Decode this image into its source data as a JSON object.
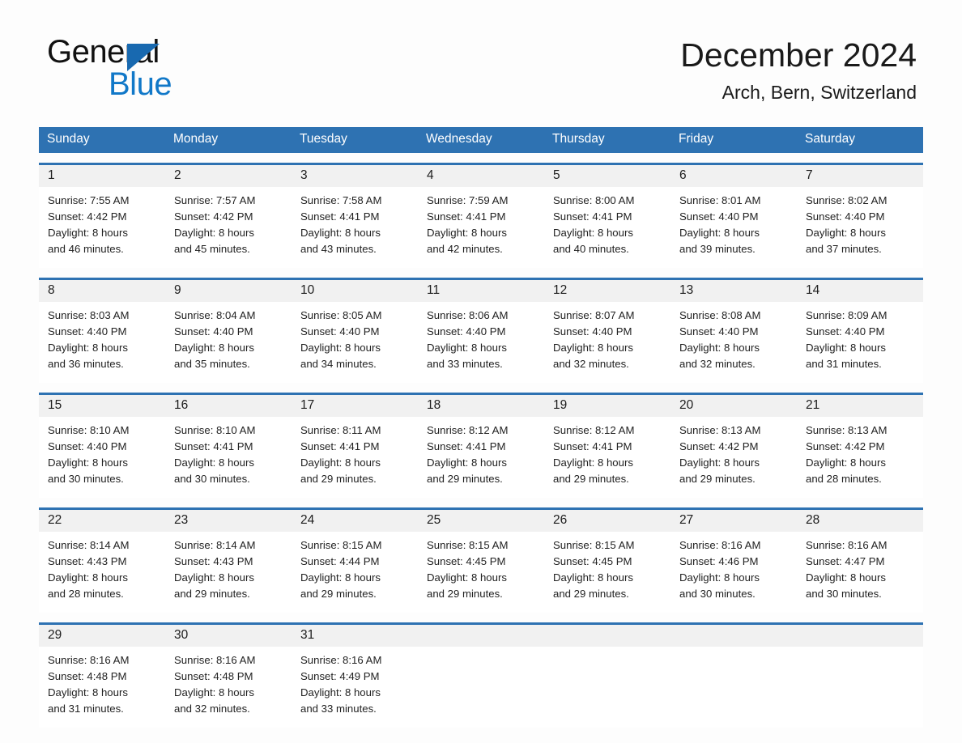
{
  "brand": {
    "name_part1": "General",
    "name_part2": "Blue",
    "logo_icon": "triangle-logo-icon",
    "colors": {
      "triangle": "#1869b0",
      "blue_text": "#1178c8"
    }
  },
  "header": {
    "month_title": "December 2024",
    "location": "Arch, Bern, Switzerland"
  },
  "theme": {
    "header_blue": "#2e72b2",
    "daynum_band": "#f1f1f1",
    "page_background": "#fdfdfd",
    "text": "#222222"
  },
  "weekdays": [
    "Sunday",
    "Monday",
    "Tuesday",
    "Wednesday",
    "Thursday",
    "Friday",
    "Saturday"
  ],
  "weeks": [
    {
      "days": [
        {
          "num": "1",
          "sunrise": "Sunrise: 7:55 AM",
          "sunset": "Sunset: 4:42 PM",
          "daylight_line1": "Daylight: 8 hours",
          "daylight_line2": "and 46 minutes."
        },
        {
          "num": "2",
          "sunrise": "Sunrise: 7:57 AM",
          "sunset": "Sunset: 4:42 PM",
          "daylight_line1": "Daylight: 8 hours",
          "daylight_line2": "and 45 minutes."
        },
        {
          "num": "3",
          "sunrise": "Sunrise: 7:58 AM",
          "sunset": "Sunset: 4:41 PM",
          "daylight_line1": "Daylight: 8 hours",
          "daylight_line2": "and 43 minutes."
        },
        {
          "num": "4",
          "sunrise": "Sunrise: 7:59 AM",
          "sunset": "Sunset: 4:41 PM",
          "daylight_line1": "Daylight: 8 hours",
          "daylight_line2": "and 42 minutes."
        },
        {
          "num": "5",
          "sunrise": "Sunrise: 8:00 AM",
          "sunset": "Sunset: 4:41 PM",
          "daylight_line1": "Daylight: 8 hours",
          "daylight_line2": "and 40 minutes."
        },
        {
          "num": "6",
          "sunrise": "Sunrise: 8:01 AM",
          "sunset": "Sunset: 4:40 PM",
          "daylight_line1": "Daylight: 8 hours",
          "daylight_line2": "and 39 minutes."
        },
        {
          "num": "7",
          "sunrise": "Sunrise: 8:02 AM",
          "sunset": "Sunset: 4:40 PM",
          "daylight_line1": "Daylight: 8 hours",
          "daylight_line2": "and 37 minutes."
        }
      ]
    },
    {
      "days": [
        {
          "num": "8",
          "sunrise": "Sunrise: 8:03 AM",
          "sunset": "Sunset: 4:40 PM",
          "daylight_line1": "Daylight: 8 hours",
          "daylight_line2": "and 36 minutes."
        },
        {
          "num": "9",
          "sunrise": "Sunrise: 8:04 AM",
          "sunset": "Sunset: 4:40 PM",
          "daylight_line1": "Daylight: 8 hours",
          "daylight_line2": "and 35 minutes."
        },
        {
          "num": "10",
          "sunrise": "Sunrise: 8:05 AM",
          "sunset": "Sunset: 4:40 PM",
          "daylight_line1": "Daylight: 8 hours",
          "daylight_line2": "and 34 minutes."
        },
        {
          "num": "11",
          "sunrise": "Sunrise: 8:06 AM",
          "sunset": "Sunset: 4:40 PM",
          "daylight_line1": "Daylight: 8 hours",
          "daylight_line2": "and 33 minutes."
        },
        {
          "num": "12",
          "sunrise": "Sunrise: 8:07 AM",
          "sunset": "Sunset: 4:40 PM",
          "daylight_line1": "Daylight: 8 hours",
          "daylight_line2": "and 32 minutes."
        },
        {
          "num": "13",
          "sunrise": "Sunrise: 8:08 AM",
          "sunset": "Sunset: 4:40 PM",
          "daylight_line1": "Daylight: 8 hours",
          "daylight_line2": "and 32 minutes."
        },
        {
          "num": "14",
          "sunrise": "Sunrise: 8:09 AM",
          "sunset": "Sunset: 4:40 PM",
          "daylight_line1": "Daylight: 8 hours",
          "daylight_line2": "and 31 minutes."
        }
      ]
    },
    {
      "days": [
        {
          "num": "15",
          "sunrise": "Sunrise: 8:10 AM",
          "sunset": "Sunset: 4:40 PM",
          "daylight_line1": "Daylight: 8 hours",
          "daylight_line2": "and 30 minutes."
        },
        {
          "num": "16",
          "sunrise": "Sunrise: 8:10 AM",
          "sunset": "Sunset: 4:41 PM",
          "daylight_line1": "Daylight: 8 hours",
          "daylight_line2": "and 30 minutes."
        },
        {
          "num": "17",
          "sunrise": "Sunrise: 8:11 AM",
          "sunset": "Sunset: 4:41 PM",
          "daylight_line1": "Daylight: 8 hours",
          "daylight_line2": "and 29 minutes."
        },
        {
          "num": "18",
          "sunrise": "Sunrise: 8:12 AM",
          "sunset": "Sunset: 4:41 PM",
          "daylight_line1": "Daylight: 8 hours",
          "daylight_line2": "and 29 minutes."
        },
        {
          "num": "19",
          "sunrise": "Sunrise: 8:12 AM",
          "sunset": "Sunset: 4:41 PM",
          "daylight_line1": "Daylight: 8 hours",
          "daylight_line2": "and 29 minutes."
        },
        {
          "num": "20",
          "sunrise": "Sunrise: 8:13 AM",
          "sunset": "Sunset: 4:42 PM",
          "daylight_line1": "Daylight: 8 hours",
          "daylight_line2": "and 29 minutes."
        },
        {
          "num": "21",
          "sunrise": "Sunrise: 8:13 AM",
          "sunset": "Sunset: 4:42 PM",
          "daylight_line1": "Daylight: 8 hours",
          "daylight_line2": "and 28 minutes."
        }
      ]
    },
    {
      "days": [
        {
          "num": "22",
          "sunrise": "Sunrise: 8:14 AM",
          "sunset": "Sunset: 4:43 PM",
          "daylight_line1": "Daylight: 8 hours",
          "daylight_line2": "and 28 minutes."
        },
        {
          "num": "23",
          "sunrise": "Sunrise: 8:14 AM",
          "sunset": "Sunset: 4:43 PM",
          "daylight_line1": "Daylight: 8 hours",
          "daylight_line2": "and 29 minutes."
        },
        {
          "num": "24",
          "sunrise": "Sunrise: 8:15 AM",
          "sunset": "Sunset: 4:44 PM",
          "daylight_line1": "Daylight: 8 hours",
          "daylight_line2": "and 29 minutes."
        },
        {
          "num": "25",
          "sunrise": "Sunrise: 8:15 AM",
          "sunset": "Sunset: 4:45 PM",
          "daylight_line1": "Daylight: 8 hours",
          "daylight_line2": "and 29 minutes."
        },
        {
          "num": "26",
          "sunrise": "Sunrise: 8:15 AM",
          "sunset": "Sunset: 4:45 PM",
          "daylight_line1": "Daylight: 8 hours",
          "daylight_line2": "and 29 minutes."
        },
        {
          "num": "27",
          "sunrise": "Sunrise: 8:16 AM",
          "sunset": "Sunset: 4:46 PM",
          "daylight_line1": "Daylight: 8 hours",
          "daylight_line2": "and 30 minutes."
        },
        {
          "num": "28",
          "sunrise": "Sunrise: 8:16 AM",
          "sunset": "Sunset: 4:47 PM",
          "daylight_line1": "Daylight: 8 hours",
          "daylight_line2": "and 30 minutes."
        }
      ]
    },
    {
      "days": [
        {
          "num": "29",
          "sunrise": "Sunrise: 8:16 AM",
          "sunset": "Sunset: 4:48 PM",
          "daylight_line1": "Daylight: 8 hours",
          "daylight_line2": "and 31 minutes."
        },
        {
          "num": "30",
          "sunrise": "Sunrise: 8:16 AM",
          "sunset": "Sunset: 4:48 PM",
          "daylight_line1": "Daylight: 8 hours",
          "daylight_line2": "and 32 minutes."
        },
        {
          "num": "31",
          "sunrise": "Sunrise: 8:16 AM",
          "sunset": "Sunset: 4:49 PM",
          "daylight_line1": "Daylight: 8 hours",
          "daylight_line2": "and 33 minutes."
        },
        {
          "num": "",
          "sunrise": "",
          "sunset": "",
          "daylight_line1": "",
          "daylight_line2": ""
        },
        {
          "num": "",
          "sunrise": "",
          "sunset": "",
          "daylight_line1": "",
          "daylight_line2": ""
        },
        {
          "num": "",
          "sunrise": "",
          "sunset": "",
          "daylight_line1": "",
          "daylight_line2": ""
        },
        {
          "num": "",
          "sunrise": "",
          "sunset": "",
          "daylight_line1": "",
          "daylight_line2": ""
        }
      ]
    }
  ]
}
